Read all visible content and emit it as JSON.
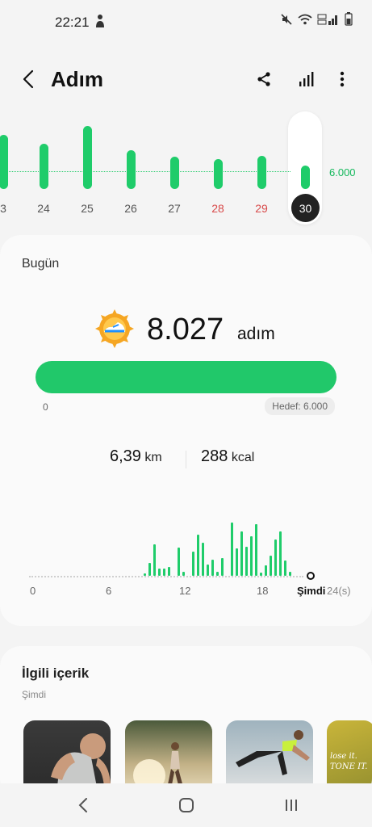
{
  "status": {
    "time": "22:21"
  },
  "header": {
    "title": "Adım"
  },
  "week": {
    "goal_label": "6.000",
    "days": [
      {
        "label": "3",
        "steps": 7000,
        "weekend": false
      },
      {
        "label": "24",
        "steps": 5900,
        "weekend": false
      },
      {
        "label": "25",
        "steps": 8200,
        "weekend": false
      },
      {
        "label": "26",
        "steps": 5000,
        "weekend": false
      },
      {
        "label": "27",
        "steps": 4200,
        "weekend": false
      },
      {
        "label": "28",
        "steps": 3900,
        "weekend": true
      },
      {
        "label": "29",
        "steps": 4300,
        "weekend": true
      }
    ],
    "selected": {
      "label": "30",
      "steps": 3000
    }
  },
  "today": {
    "heading": "Bugün",
    "steps_value": "8.027",
    "steps_unit": "adım",
    "progress_fraction": 1.0,
    "progress_start": "0",
    "goal_chip": "Hedef: 6.000",
    "distance_value": "6,39",
    "distance_unit": "km",
    "calories_value": "288",
    "calories_unit": "kcal",
    "hourly_ticks": [
      "0",
      "6",
      "12",
      "18"
    ],
    "now_label": "Şimdi",
    "end_label": "24(s)",
    "hourly_steps": [
      0,
      0,
      0,
      0,
      0,
      0,
      0,
      0.04,
      0.21,
      0.5,
      0.12,
      0.11,
      0.14,
      0,
      0.45,
      0.06,
      0,
      0.38,
      0.66,
      0.52,
      0.18,
      0.26,
      0.06,
      0.28,
      0,
      0.84,
      0.44,
      0.71,
      0.46,
      0.63,
      0.82,
      0.05,
      0.17,
      0.32,
      0.58,
      0.7,
      0.24,
      0.06
    ]
  },
  "related": {
    "title": "İlgili içerik",
    "subtitle": "Şimdi",
    "thumb_text": "lose it. TONE IT."
  }
}
